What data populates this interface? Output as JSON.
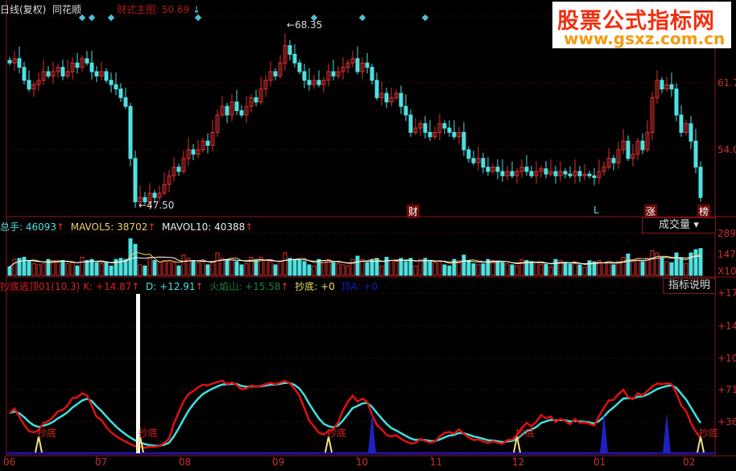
{
  "header": {
    "title": "日线(复权)",
    "stock": "同花顺",
    "main_formula": "财式主图: 50.69",
    "arrow_down": "↓"
  },
  "watermark": {
    "name": "股票公式指标网",
    "url": "www.gsxz.com.cn"
  },
  "price_chart": {
    "max_label": "68.35",
    "min_label": "47.50",
    "axis": [
      "61.7",
      "54.0"
    ],
    "markers": [
      {
        "label": "财",
        "i": 83
      },
      {
        "label": "L",
        "i": 121
      },
      {
        "label": "涨",
        "i": 132
      },
      {
        "label": "榜",
        "i": 143
      }
    ],
    "closes": [
      64,
      64.5,
      63.5,
      62,
      61,
      61.5,
      62,
      63,
      62.5,
      63,
      63.5,
      62.5,
      63,
      64,
      63.5,
      64.5,
      64,
      63,
      62.5,
      63,
      62,
      61.5,
      61,
      60,
      59,
      53,
      48,
      48.5,
      48,
      49,
      48.5,
      49,
      50,
      51,
      52,
      51.5,
      53,
      54,
      53.5,
      54,
      55,
      54.5,
      56,
      58,
      59,
      58,
      59.5,
      58.5,
      58,
      59,
      60,
      59.5,
      61,
      62,
      63,
      62.5,
      64,
      66,
      65,
      64,
      63,
      62,
      61.5,
      62,
      61.5,
      62,
      63,
      62.5,
      63,
      63.5,
      64,
      64.5,
      63,
      64,
      63.5,
      62,
      60,
      60.5,
      59.5,
      60,
      60.5,
      59,
      58,
      56,
      56.5,
      57,
      56,
      55.5,
      56,
      57,
      56.5,
      56,
      55.5,
      56,
      54,
      53,
      52.5,
      53,
      52,
      51.5,
      52,
      51.5,
      51,
      51.5,
      51,
      51.5,
      52,
      51.5,
      51,
      51.5,
      51.8,
      51.2,
      51.5,
      51,
      51.5,
      51.2,
      51,
      51.5,
      51,
      51.2,
      51,
      50.8,
      51.5,
      52,
      53,
      52.5,
      54,
      55,
      53,
      53.5,
      55,
      54,
      56,
      60,
      62,
      61,
      61.5,
      61,
      58,
      56,
      57,
      55,
      52,
      48.5
    ],
    "diamonds": [
      15,
      17,
      21,
      39,
      63,
      73,
      86
    ]
  },
  "volume": {
    "label": "总手: 46093",
    "mavol5": "MAVOL5: 38702",
    "mavol10": "MAVOL10: 40388",
    "up": "↑",
    "selector": "成交量",
    "axis": [
      "289",
      "147",
      "X10"
    ]
  },
  "indicator": {
    "name": "抄底逃顶01(10,3)",
    "k": "K: +14.87",
    "d": "D: +12.91",
    "fire": "火焰山: +15.58",
    "bottom": "抄底: +0",
    "top": "顶A: +0",
    "up": "↑",
    "help": "指标说明",
    "axis": [
      "+17",
      "+14",
      "+10",
      "+71",
      "+36"
    ],
    "signal_label": "抄底"
  },
  "x_axis": [
    "06",
    "07",
    "08",
    "09",
    "10",
    "11",
    "12",
    "01",
    "02"
  ],
  "colors": {
    "up": "#e03030",
    "down": "#50e0e0",
    "k": "#e01010",
    "d": "#40e0e0",
    "grid": "#6a1010"
  }
}
